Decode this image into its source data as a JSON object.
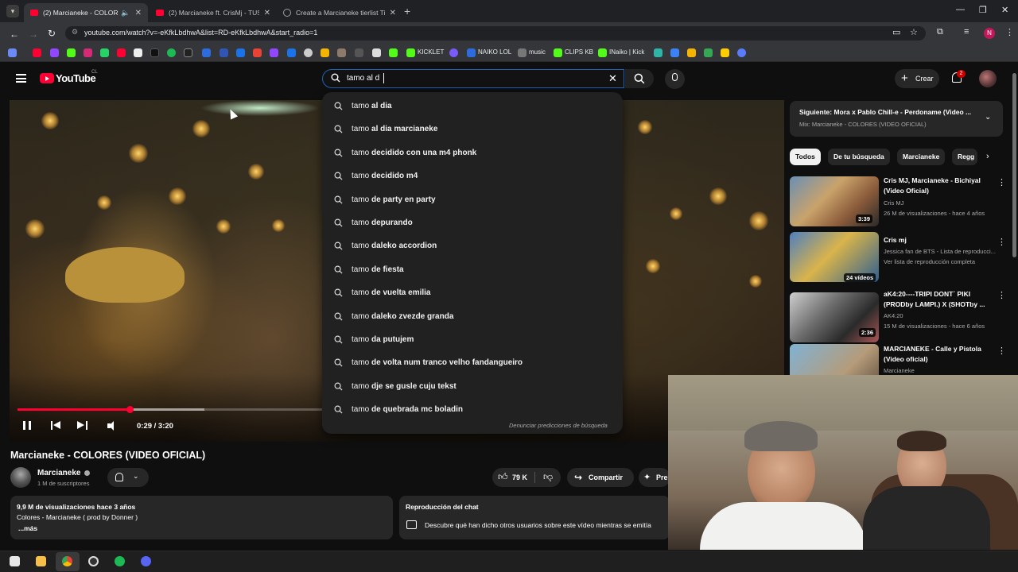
{
  "browser": {
    "tabs": [
      {
        "title": "(2) Marcianeke - COLORES",
        "active": true
      },
      {
        "title": "(2) Marcianeke ft. CrisMj - TUS",
        "active": false
      },
      {
        "title": "Create a Marcianeke tierlist Tie",
        "active": false
      }
    ],
    "url": "youtube.com/watch?v=-eKfkLbdhwA&list=RD-eKfkLbdhwA&start_radio=1",
    "profile_initial": "N",
    "bookmarks": [
      "KICKLET",
      "NAIKO LOL",
      "music",
      "CLIPS KB",
      "INaiko | Kick"
    ]
  },
  "youtube": {
    "logo_text": "YouTube",
    "country_code": "CL",
    "search": {
      "query": "tamo al d",
      "suggestions": [
        {
          "typed": "tamo ",
          "rest": "al dia"
        },
        {
          "typed": "tamo ",
          "rest": "al dia marcianeke"
        },
        {
          "typed": "tamo ",
          "rest": "decidido con una m4 phonk"
        },
        {
          "typed": "tamo ",
          "rest": "decidido m4"
        },
        {
          "typed": "tamo ",
          "rest": "de party en party"
        },
        {
          "typed": "tamo ",
          "rest": "depurando"
        },
        {
          "typed": "tamo ",
          "rest": "daleko accordion"
        },
        {
          "typed": "tamo ",
          "rest": "de fiesta"
        },
        {
          "typed": "tamo ",
          "rest": "de vuelta emilia"
        },
        {
          "typed": "tamo ",
          "rest": "daleko zvezde granda"
        },
        {
          "typed": "tamo ",
          "rest": "da putujem"
        },
        {
          "typed": "tamo ",
          "rest": "de volta num tranco velho fandangueiro"
        },
        {
          "typed": "tamo ",
          "rest": "dje se gusle cuju tekst"
        },
        {
          "typed": "tamo ",
          "rest": "de quebrada mc boladin"
        }
      ],
      "report_text": "Denunciar predicciones de búsqueda"
    },
    "create_label": "Crear",
    "notif_count": "2",
    "player": {
      "time": "0:29 / 3:20",
      "progress_fraction": 0.145
    },
    "video": {
      "title": "Marcianeke - COLORES (VIDEO OFICIAL)",
      "channel": "Marcianeke",
      "subscribers": "1 M de suscriptores",
      "likes": "79 K",
      "share_label": "Compartir",
      "more_label": "Pre",
      "views_line": "9,9 M de visualizaciones  hace 3 años",
      "desc_line": "Colores - Marcianeke ( prod by Donner )",
      "more_text": "...más"
    },
    "chat": {
      "title": "Reproducción del chat",
      "text": "Descubre qué han dicho otros usuarios sobre este vídeo mientras se emitía"
    },
    "up_next": {
      "label": "Siguiente: Mora x Pablo Chill-e - Perdoname (Video ...",
      "mix": "Mix: Marcianeke - COLORES (VIDEO OFICIAL)"
    },
    "chips": [
      "Todos",
      "De tu búsqueda",
      "Marcianeke",
      "Regg"
    ],
    "recommendations": [
      {
        "title": "Cris MJ, Marcianeke - Bichiyal (Video Oficial)",
        "channel": "Cris MJ",
        "meta": "26 M de visualizaciones - hace 4 años",
        "badge": "3:39"
      },
      {
        "title": "Cris mj",
        "channel": "Jessica fan de BTS - Lista de reproducci...",
        "meta": "Ver lista de reproducción completa",
        "badge": "24 vídeos"
      },
      {
        "title": "aK4:20----TRIPI DONT´ PIKI (PRODby LAMPI.) X (SHOTby ...",
        "channel": "AK4:20",
        "meta": "15 M de visualizaciones - hace 6 años",
        "badge": "2:36"
      },
      {
        "title": "MARCIANEKE - Calle y Pistola (Video oficial)",
        "channel": "Marcianeke",
        "meta": "",
        "badge": ""
      }
    ]
  }
}
